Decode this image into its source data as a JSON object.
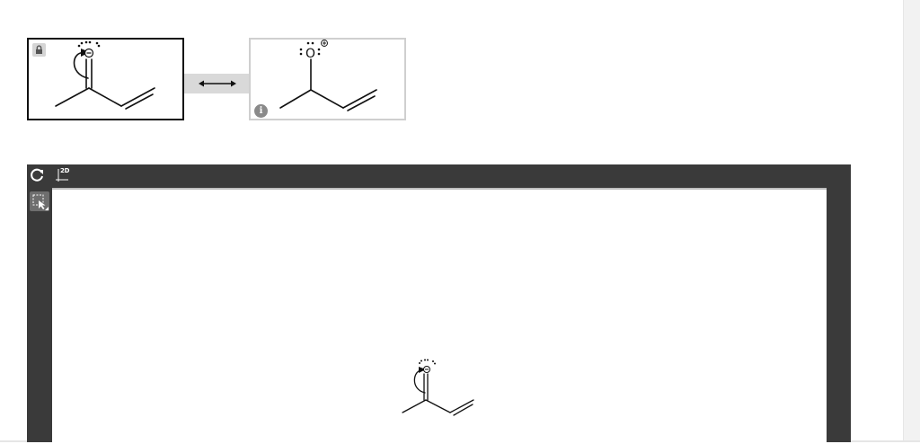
{
  "resonance": {
    "structures": [
      {
        "name": "selected-structure",
        "atom_label": "O",
        "charge": "−",
        "locked": true
      },
      {
        "name": "resonance-structure",
        "atom_label": "O",
        "charge": "+",
        "info": "i"
      }
    ],
    "connector": "resonance-arrow"
  },
  "editor": {
    "tools": [
      {
        "name": "refresh",
        "icon": "refresh-icon"
      },
      {
        "name": "clean-2d",
        "icon": "2d-icon",
        "label": "2D"
      },
      {
        "name": "select",
        "icon": "select-lasso-icon"
      }
    ],
    "molecule": {
      "atom_label": "O",
      "charge": "−"
    }
  },
  "colors": {
    "editor_bg": "#3a3a3a",
    "canvas_bg": "#ffffff",
    "accent": "#111111"
  }
}
